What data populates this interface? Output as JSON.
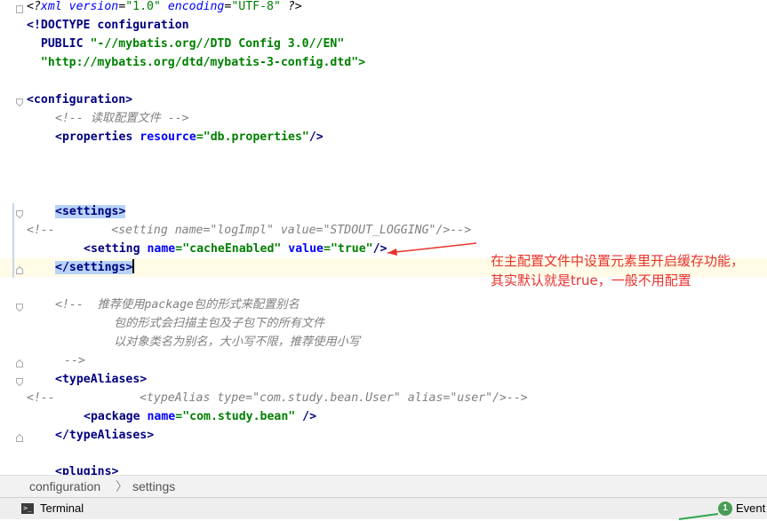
{
  "code_lines": {
    "l1": {
      "a": "<?",
      "b": "xml version",
      "c": "=",
      "d": "\"1.0\"",
      "e": " encoding",
      "f": "=",
      "g": "\"UTF-8\"",
      "h": " ?>"
    },
    "l2": {
      "a": "<!DOCTYPE configuration"
    },
    "l3": {
      "a": "  PUBLIC ",
      "b": "\"-//mybatis.org//DTD Config 3.0//EN\""
    },
    "l4": {
      "a": "  \"http://mybatis.org/dtd/mybatis-3-config.dtd\">"
    },
    "l6": {
      "a": "<configuration>"
    },
    "l7": {
      "a": "<!-- 读取配置文件 -->"
    },
    "l8": {
      "a": "<properties ",
      "b": "resource",
      "c": "=",
      "d": "\"db.properties\"",
      "e": "/>"
    },
    "l12": {
      "a": "<settings>"
    },
    "l13": {
      "a": "<!--        <setting name=\"logImpl\" value=\"STDOUT_LOGGING\"/>-->"
    },
    "l14": {
      "a": "<setting ",
      "b": "name",
      "c": "=",
      "d": "\"cacheEnabled\"",
      "e": " value",
      "f": "=",
      "g": "\"true\"",
      "h": "/>"
    },
    "l15": {
      "a": "</settings>"
    },
    "l17": {
      "a": "<!--  推荐使用package包的形式来配置别名"
    },
    "l18": {
      "a": "包的形式会扫描主包及子包下的所有文件"
    },
    "l19": {
      "a": "以对象类名为别名，大小写不限，推荐使用小写"
    },
    "l20": {
      "a": "-->"
    },
    "l21": {
      "a": "<typeAliases>"
    },
    "l22": {
      "a": "<!--            <typeAlias type=\"com.study.bean.User\" alias=\"user\"/>-->"
    },
    "l23": {
      "a": "<package ",
      "b": "name",
      "c": "=",
      "d": "\"com.study.bean\"",
      "e": " />"
    },
    "l24": {
      "a": "</typeAliases>"
    },
    "l26": {
      "a": "<plugins>"
    }
  },
  "annotation": {
    "text": "在主配置文件中设置元素里开启缓存功能，其实默认就是true，一般不用配置",
    "color": "#e8322c"
  },
  "breadcrumb": {
    "item1": "configuration",
    "sep": "〉",
    "item2": "settings"
  },
  "statusbar": {
    "terminal_label": "Terminal",
    "event_badge": "1",
    "event_label": "Event"
  },
  "colors": {
    "tag": "#000080",
    "attr": "#0000ff",
    "value": "#008000",
    "comment": "#808080",
    "selection": "#b7d3f7",
    "caret_row": "#fffbe6"
  }
}
